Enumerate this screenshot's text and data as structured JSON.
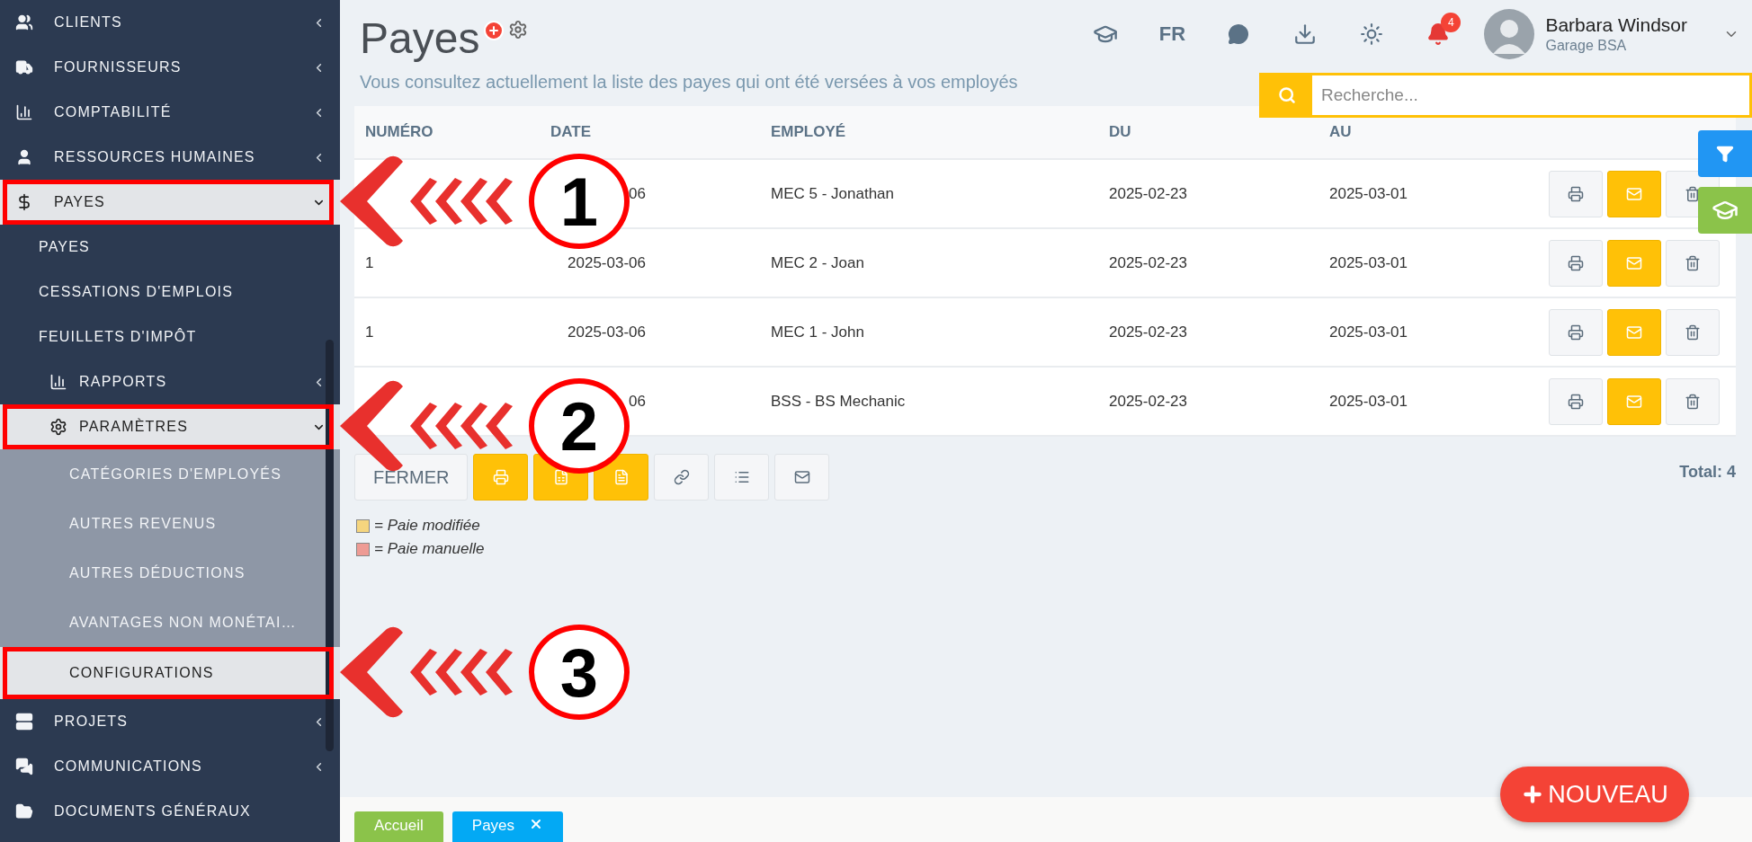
{
  "sidebar": {
    "items": [
      {
        "label": "CLIENTS",
        "expanded": false,
        "selected": false
      },
      {
        "label": "FOURNISSEURS",
        "expanded": false,
        "selected": false
      },
      {
        "label": "COMPTABILITÉ",
        "expanded": false,
        "selected": false
      },
      {
        "label": "RESSOURCES HUMAINES",
        "expanded": false,
        "selected": false
      },
      {
        "label": "PAYES",
        "expanded": true,
        "selected": true,
        "children": [
          {
            "label": "PAYES",
            "selected": false
          },
          {
            "label": "CESSATIONS D'EMPLOIS",
            "selected": false
          },
          {
            "label": "FEUILLETS D'IMPÔT",
            "selected": false
          },
          {
            "label": "RAPPORTS",
            "expanded": false,
            "selected": false
          },
          {
            "label": "PARAMÈTRES",
            "expanded": true,
            "selected": true,
            "children": [
              {
                "label": "CATÉGORIES D'EMPLOYÉS",
                "selected": false
              },
              {
                "label": "AUTRES REVENUS",
                "selected": false
              },
              {
                "label": "AUTRES DÉDUCTIONS",
                "selected": false
              },
              {
                "label": "AVANTAGES NON MONÉTAI…",
                "selected": false
              },
              {
                "label": "CONFIGURATIONS",
                "selected": true
              }
            ]
          }
        ]
      },
      {
        "label": "PROJETS",
        "expanded": false,
        "selected": false
      },
      {
        "label": "COMMUNICATIONS",
        "expanded": false,
        "selected": false
      },
      {
        "label": "DOCUMENTS GÉNÉRAUX",
        "selected": false
      }
    ]
  },
  "header": {
    "title": "Payes",
    "subtitle": "Vous consultez actuellement la liste des payes qui ont été versées à vos employés",
    "language": "FR",
    "notifications": "4",
    "user": {
      "name": "Barbara Windsor",
      "company": "Garage BSA"
    },
    "search": {
      "placeholder": "Recherche..."
    }
  },
  "table": {
    "columns": [
      "NUMÉRO",
      "DATE",
      "EMPLOYÉ",
      "DU",
      "AU"
    ],
    "rows": [
      {
        "date": "06",
        "employee": "MEC 5 - Jonathan",
        "from": "2025-02-23",
        "to": "2025-03-01"
      },
      {
        "number": "1",
        "date": "2025-03-06",
        "employee": "MEC 2 - Joan",
        "from": "2025-02-23",
        "to": "2025-03-01"
      },
      {
        "number": "1",
        "date": "2025-03-06",
        "employee": "MEC 1 - John",
        "from": "2025-02-23",
        "to": "2025-03-01"
      },
      {
        "date": "06",
        "employee": "BSS - BS Mechanic",
        "from": "2025-02-23",
        "to": "2025-03-01"
      }
    ]
  },
  "toolbar": [
    {
      "kind": "text",
      "label": "FERMER",
      "highlighted": false
    },
    {
      "kind": "icon",
      "highlighted": true
    },
    {
      "kind": "icon",
      "highlighted": true
    },
    {
      "kind": "icon",
      "highlighted": true
    },
    {
      "kind": "icon",
      "highlighted": false
    },
    {
      "kind": "icon",
      "highlighted": false
    },
    {
      "kind": "icon",
      "highlighted": false
    }
  ],
  "total": "Total: 4",
  "legend": [
    {
      "color": "#f5d57e",
      "label": "= Paie modifiée"
    },
    {
      "color": "#ee9b94",
      "label": "= Paie manuelle"
    }
  ],
  "new_button": "NOUVEAU",
  "bottom_tabs": [
    {
      "label": "Accueil",
      "color": "#8bc34a",
      "closable": false
    },
    {
      "label": "Payes",
      "color": "#03a9f4",
      "closable": true
    }
  ],
  "annotations": [
    {
      "label": "1"
    },
    {
      "label": "2"
    },
    {
      "label": "3"
    }
  ]
}
